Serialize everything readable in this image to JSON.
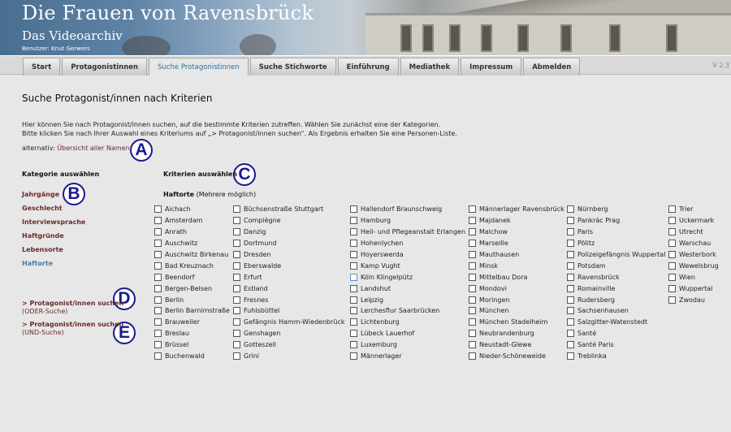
{
  "header": {
    "title": "Die Frauen von Ravensbrück",
    "subtitle": "Das Videoarchiv",
    "user": "Benutzer: Knut Gerwers"
  },
  "nav": {
    "items": [
      "Start",
      "Protagonistinnen",
      "Suche Protagonistinnen",
      "Suche Stichworte",
      "Einführung",
      "Mediathek",
      "Impressum",
      "Abmelden"
    ],
    "active": "Suche Protagonistinnen",
    "version": "V 2.3"
  },
  "page": {
    "heading": "Suche Protagonist/innen nach Kriterien",
    "intro_line1": "Hier können Sie nach Protagonist/innen suchen, auf die bestimmte Kriterien zutreffen. Wählen Sie zunächst eine der Kategorien.",
    "intro_line2": "Bitte klicken Sie nach Ihrer Auswahl eines Kriteriums auf „> Protagonist/innen suchen“. Als Ergebnis erhalten Sie eine Personen-Liste.",
    "alternativ_label": "alternativ:",
    "alternativ_link": "Übersicht aller Namen"
  },
  "markers": {
    "a": "A",
    "b": "B",
    "c": "C",
    "d": "D",
    "e": "E"
  },
  "categories": {
    "heading": "Kategorie auswählen",
    "items": [
      "Jahrgänge",
      "Geschlecht",
      "Interviewsprache",
      "Haftgründe",
      "Lebensorte",
      "Haftorte"
    ],
    "active": "Haftorte"
  },
  "search_links": {
    "oder_link": "> Protagonist/innen suchen",
    "oder_sub": "(ODER-Suche)",
    "und_link": "> Protagonist/innen suchen",
    "und_sub": "(UND-Suche)"
  },
  "criteria": {
    "heading": "Kriterien auswählen",
    "sub_bold": "Haftorte",
    "sub_note": "(Mehrere möglich)",
    "columns": [
      [
        "Aichach",
        "Amsterdam",
        "Anrath",
        "Auschwitz",
        "Auschwitz Birkenau",
        "Bad Kreuznach",
        "Beendorf",
        "Bergen-Belsen",
        "Berlin",
        "Berlin Barnimstraße",
        "Brauweiler",
        "Breslau",
        "Brüssel",
        "Buchenwald"
      ],
      [
        "Büchsenstraße Stuttgart",
        "Compiègne",
        "Danzig",
        "Dortmund",
        "Dresden",
        "Eberswalde",
        "Erfurt",
        "Estland",
        "Fresnes",
        "Fuhlsbüttel",
        "Gefängnis Hamm-Wiedenbrück",
        "Genshagen",
        "Gotteszell",
        "Grini"
      ],
      [
        "Hallendorf Braunschweig",
        "Hamburg",
        "Heil- und Pflegeanstalt Erlangen",
        "Hohenlychen",
        "Hoyerswerda",
        "Kamp Vught",
        "Köln Klingelpütz",
        "Landshut",
        "Leipzig",
        "Lerchesflur Saarbrücken",
        "Lichtenburg",
        "Lübeck Lauerhof",
        "Luxemburg",
        "Männerlager"
      ],
      [
        "Männerlager Ravensbrück",
        "Majdanek",
        "Malchow",
        "Marseille",
        "Mauthausen",
        "Minsk",
        "Mittelbau Dora",
        "Mondovi",
        "Moringen",
        "München",
        "München Stadelheim",
        "Neubrandenburg",
        "Neustadt-Glewe",
        "Nieder-Schöneweide"
      ],
      [
        "Nürnberg",
        "Pankrác Prag",
        "Paris",
        "Pölitz",
        "Polizeigefängnis Wuppertal",
        "Potsdam",
        "Ravensbrück",
        "Romainville",
        "Rudersberg",
        "Sachsenhausen",
        "Salzgitter-Watenstedt",
        "Santé",
        "Santé Paris",
        "Treblinka"
      ],
      [
        "Trier",
        "Uckermark",
        "Utrecht",
        "Warschau",
        "Westerbork",
        "Wewelsbrug",
        "Wien",
        "Wuppertal",
        "Zwodau"
      ]
    ],
    "focused": "Köln Klingelpütz"
  }
}
